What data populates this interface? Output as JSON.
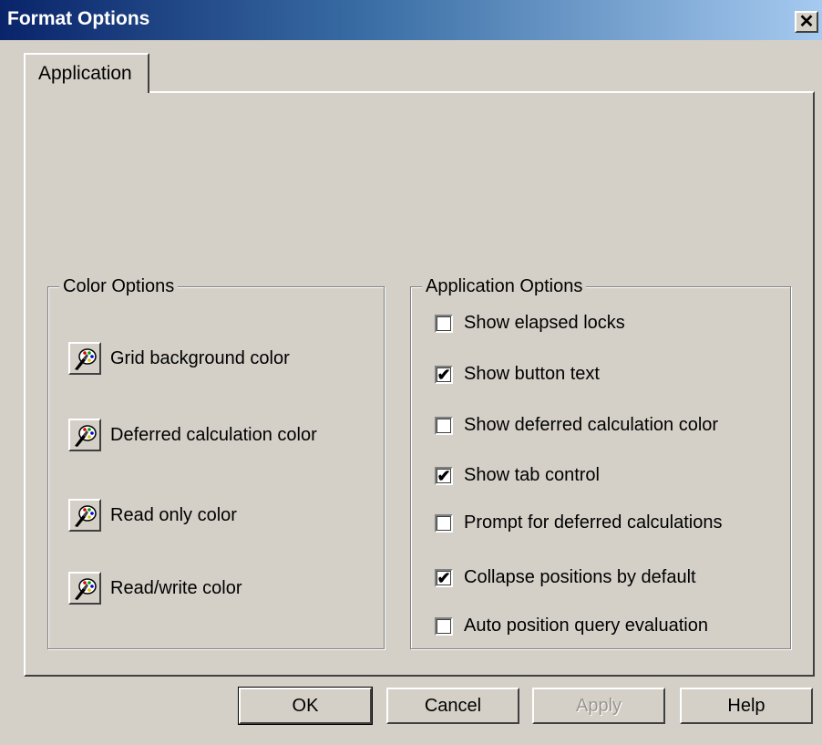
{
  "window": {
    "title": "Format Options",
    "close_glyph": "✕"
  },
  "tabs": [
    {
      "label": "Application",
      "active": true
    }
  ],
  "color_options": {
    "label": "Color Options",
    "items": [
      {
        "label": "Grid background color",
        "icon": "palette-icon"
      },
      {
        "label": "Deferred calculation color",
        "icon": "palette-icon"
      },
      {
        "label": "Read only color",
        "icon": "palette-icon"
      },
      {
        "label": "Read/write color",
        "icon": "palette-icon"
      }
    ]
  },
  "application_options": {
    "label": "Application Options",
    "items": [
      {
        "label": "Show elapsed locks",
        "checked": false
      },
      {
        "label": "Show button text",
        "checked": true
      },
      {
        "label": "Show deferred calculation color",
        "checked": false
      },
      {
        "label": "Show tab control",
        "checked": true
      },
      {
        "label": "Prompt for deferred calculations",
        "checked": false
      },
      {
        "label": "Collapse positions by default",
        "checked": true
      },
      {
        "label": "Auto position query evaluation",
        "checked": false
      }
    ]
  },
  "buttons": {
    "ok": "OK",
    "cancel": "Cancel",
    "apply": "Apply",
    "help": "Help"
  },
  "colors": {
    "title_start": "#0a246a",
    "title_end": "#a6caf0",
    "face": "#d4d0c8"
  }
}
